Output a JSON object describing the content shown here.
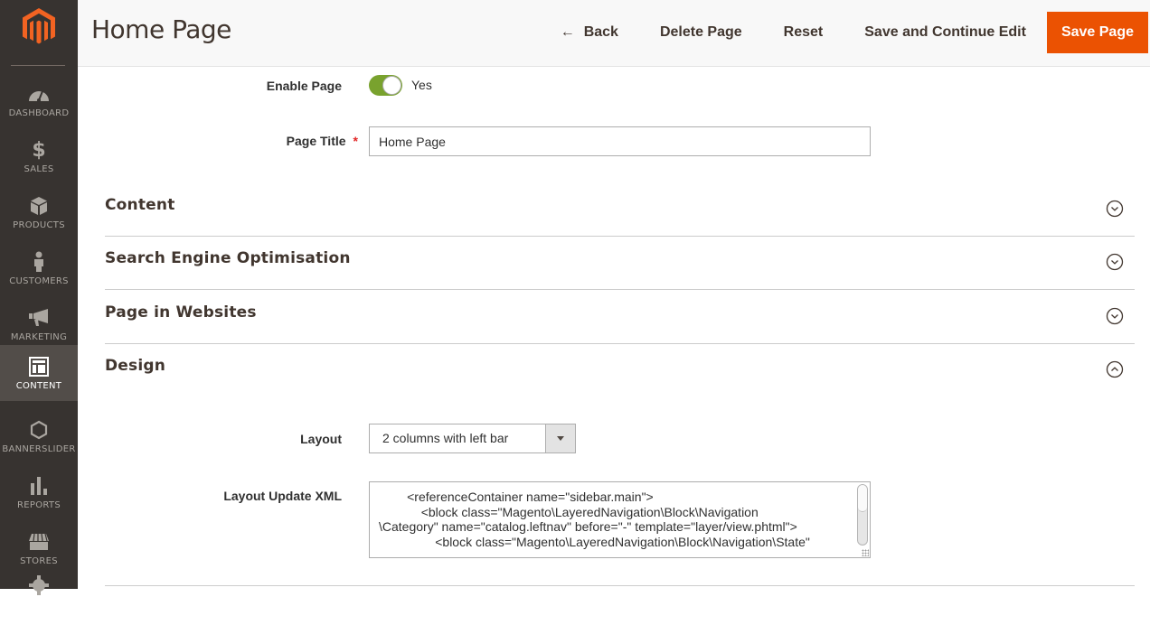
{
  "sidebar": {
    "logo": "magento-logo",
    "items": [
      {
        "label": "DASHBOARD",
        "icon": "dashboard-icon",
        "active": false
      },
      {
        "label": "SALES",
        "icon": "dollar-icon",
        "active": false
      },
      {
        "label": "PRODUCTS",
        "icon": "box-icon",
        "active": false
      },
      {
        "label": "CUSTOMERS",
        "icon": "person-icon",
        "active": false
      },
      {
        "label": "MARKETING",
        "icon": "megaphone-icon",
        "active": false
      },
      {
        "label": "CONTENT",
        "icon": "layout-icon",
        "active": true
      },
      {
        "label": "BANNERSLIDER",
        "icon": "hexagon-icon",
        "active": false
      },
      {
        "label": "REPORTS",
        "icon": "bar-chart-icon",
        "active": false
      },
      {
        "label": "STORES",
        "icon": "store-icon",
        "active": false
      }
    ]
  },
  "header": {
    "title": "Home Page",
    "actions": {
      "back": "Back",
      "delete": "Delete Page",
      "reset": "Reset",
      "save_continue": "Save and Continue Edit",
      "save": "Save Page"
    }
  },
  "form": {
    "enable_page": {
      "label": "Enable Page",
      "value": "Yes",
      "enabled": true
    },
    "page_title": {
      "label": "Page Title",
      "required_mark": "*",
      "value": "Home Page"
    }
  },
  "sections": [
    {
      "title": "Content",
      "expanded": false
    },
    {
      "title": "Search Engine Optimisation",
      "expanded": false
    },
    {
      "title": "Page in Websites",
      "expanded": false
    },
    {
      "title": "Design",
      "expanded": true
    }
  ],
  "design": {
    "layout": {
      "label": "Layout",
      "value": "2 columns with left bar"
    },
    "layout_xml": {
      "label": "Layout Update XML",
      "value": "        <referenceContainer name=\"sidebar.main\">\n            <block class=\"Magento\\LayeredNavigation\\Block\\Navigation\n\\Category\" name=\"catalog.leftnav\" before=\"-\" template=\"layer/view.phtml\">\n                <block class=\"Magento\\LayeredNavigation\\Block\\Navigation\\State\""
    }
  },
  "colors": {
    "accent": "#eb5202",
    "sidebar_bg": "#373330",
    "toggle_on": "#79a22e"
  }
}
